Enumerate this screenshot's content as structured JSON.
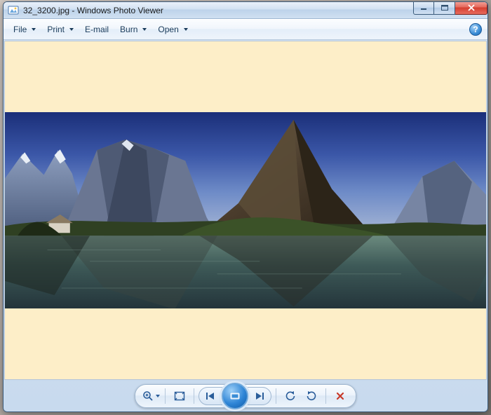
{
  "window": {
    "filename": "32_3200.jpg",
    "app_name": "Windows Photo Viewer",
    "title_sep": " - "
  },
  "menu": {
    "file": "File",
    "print": "Print",
    "email": "E-mail",
    "burn": "Burn",
    "open": "Open"
  },
  "help": {
    "label": "?"
  },
  "toolbar": {
    "zoom": "zoom-dropdown",
    "fit": "fit-to-window",
    "prev": "previous",
    "play": "slideshow",
    "next": "next",
    "rotate_ccw": "rotate-counterclockwise",
    "rotate_cw": "rotate-clockwise",
    "delete": "delete"
  },
  "image": {
    "alt": "Mountain landscape with lake"
  }
}
